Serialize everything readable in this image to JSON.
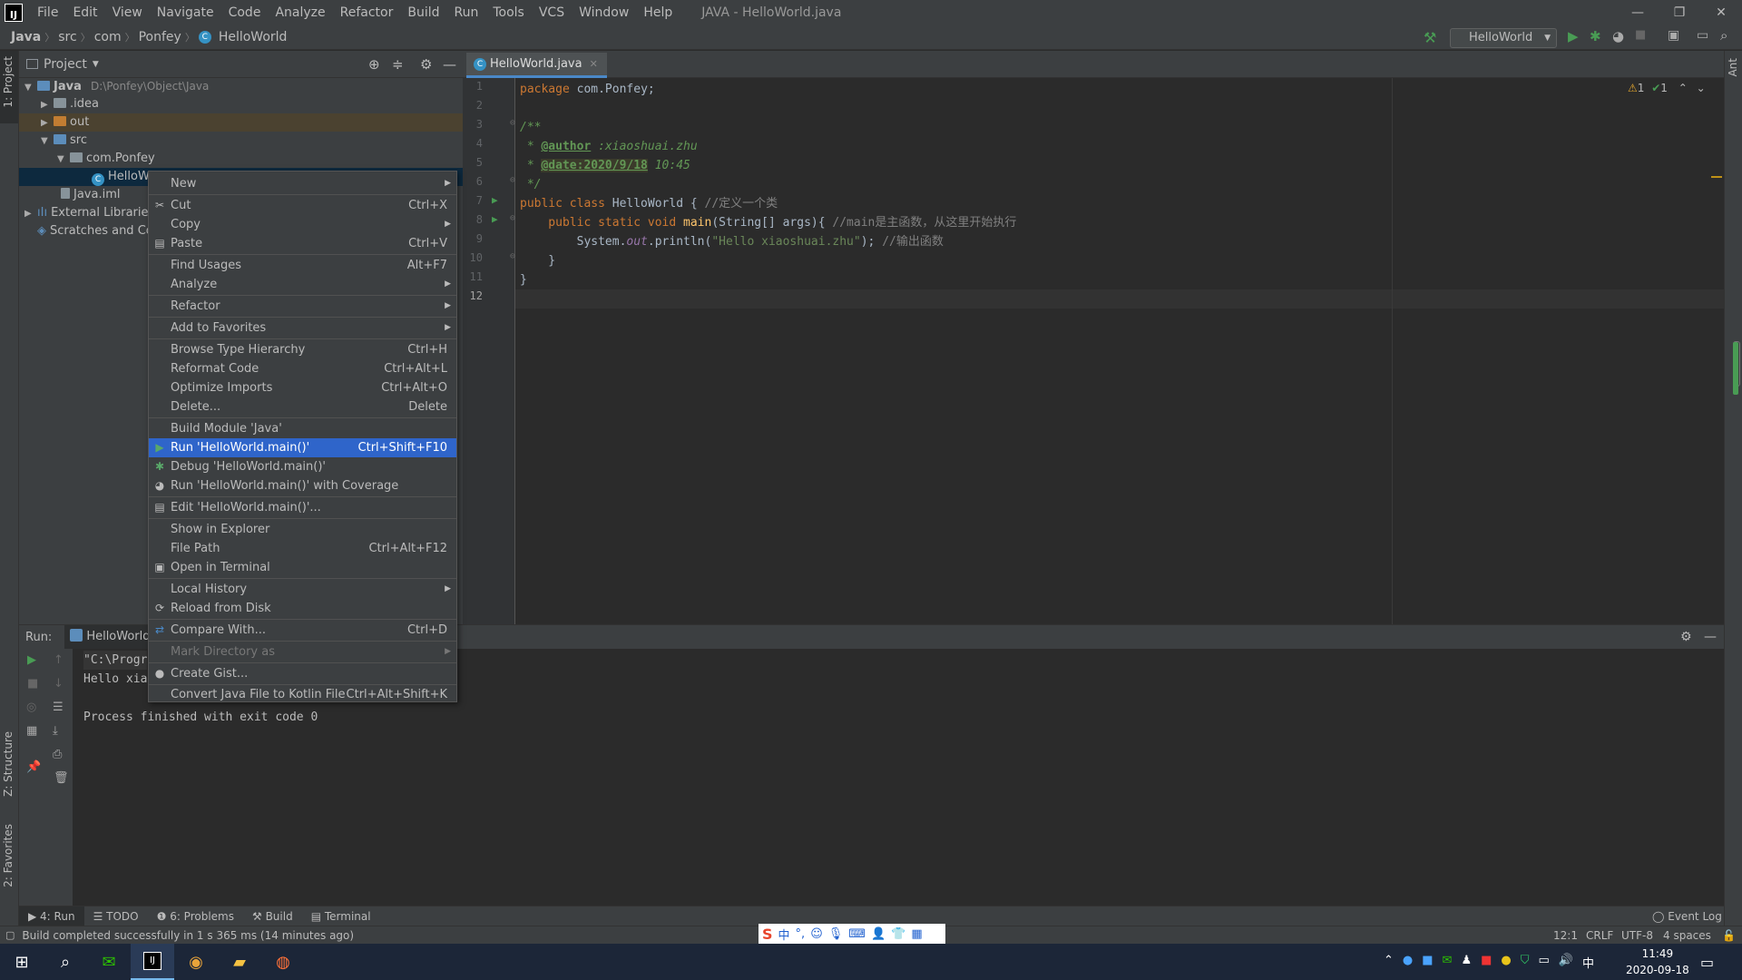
{
  "menubar": {
    "items": [
      "File",
      "Edit",
      "View",
      "Navigate",
      "Code",
      "Analyze",
      "Refactor",
      "Build",
      "Run",
      "Tools",
      "VCS",
      "Window",
      "Help"
    ],
    "window_title": "JAVA - HelloWorld.java",
    "min": "—",
    "restore": "❐",
    "close": "✕"
  },
  "navbar": {
    "crumbs": [
      "Java",
      "src",
      "com",
      "Ponfey",
      "HelloWorld"
    ],
    "run_config": "HelloWorld"
  },
  "left_strip": {
    "project": "1: Project",
    "structure": "Z: Structure",
    "favorites": "2: Favorites"
  },
  "right_strip": {
    "ant": "Ant"
  },
  "project": {
    "title": "Project",
    "tree": [
      {
        "label": "Java",
        "extra": "D:\\Ponfey\\Object\\Java"
      },
      {
        "label": ".idea"
      },
      {
        "label": "out"
      },
      {
        "label": "src"
      },
      {
        "label": "com.Ponfey"
      },
      {
        "label": "HelloWo"
      },
      {
        "label": "Java.iml"
      },
      {
        "label": "External Libraries"
      },
      {
        "label": "Scratches and Co"
      }
    ]
  },
  "editor": {
    "tab": "HelloWorld.java",
    "inspection": {
      "warnings": "1",
      "ok": "1"
    },
    "line_numbers": [
      "1",
      "2",
      "3",
      "4",
      "5",
      "6",
      "7",
      "8",
      "9",
      "10",
      "11",
      "12"
    ],
    "code": {
      "l1_kw": "package",
      "l1_rest": " com.Ponfey;",
      "l3": "/**",
      "l4_pre": " * ",
      "l4_tag": "@author",
      "l4_rest": " :xiaoshuai.zhu",
      "l5_pre": " * ",
      "l5_tag": "@date:2020/9/18",
      "l5_rest": " 10:45",
      "l6": " */",
      "l7_kw": "public class",
      "l7_rest": " HelloWorld { ",
      "l7_cm": "//定义一个类",
      "l8_kw": "    public static void",
      "l8_fn": " main",
      "l8_rest": "(String[] args){ ",
      "l8_cm": "//main是主函数，从这里开始执行",
      "l9_pre": "        System.",
      "l9_it": "out",
      "l9_mid": ".println(",
      "l9_str": "\"Hello xiaoshuai.zhu\"",
      "l9_end": "); ",
      "l9_cm": "//输出函数",
      "l10": "    }",
      "l11": "}"
    }
  },
  "run": {
    "label": "Run:",
    "tab": "HelloWorld",
    "output": [
      "\"C:\\Progr",
      "Hello xia",
      "",
      "Process finished with exit code 0"
    ]
  },
  "context_menu": {
    "items": [
      {
        "label": "New",
        "shortcut": "",
        "submenu": true
      },
      {
        "label": "Cut",
        "shortcut": "Ctrl+X",
        "icon": "✂"
      },
      {
        "label": "Copy",
        "shortcut": "",
        "submenu": true
      },
      {
        "label": "Paste",
        "shortcut": "Ctrl+V",
        "icon": "📋"
      },
      {
        "label": "Find Usages",
        "shortcut": "Alt+F7"
      },
      {
        "label": "Analyze",
        "shortcut": "",
        "submenu": true
      },
      {
        "label": "Refactor",
        "shortcut": "",
        "submenu": true
      },
      {
        "label": "Add to Favorites",
        "shortcut": "",
        "submenu": true
      },
      {
        "label": "Browse Type Hierarchy",
        "shortcut": "Ctrl+H"
      },
      {
        "label": "Reformat Code",
        "shortcut": "Ctrl+Alt+L"
      },
      {
        "label": "Optimize Imports",
        "shortcut": "Ctrl+Alt+O"
      },
      {
        "label": "Delete...",
        "shortcut": "Delete"
      },
      {
        "label": "Build Module 'Java'",
        "shortcut": ""
      },
      {
        "label": "Run 'HelloWorld.main()'",
        "shortcut": "Ctrl+Shift+F10"
      },
      {
        "label": "Debug 'HelloWorld.main()'",
        "shortcut": ""
      },
      {
        "label": "Run 'HelloWorld.main()' with Coverage",
        "shortcut": ""
      },
      {
        "label": "Edit 'HelloWorld.main()'...",
        "shortcut": ""
      },
      {
        "label": "Show in Explorer",
        "shortcut": ""
      },
      {
        "label": "File Path",
        "shortcut": "Ctrl+Alt+F12"
      },
      {
        "label": "Open in Terminal",
        "shortcut": ""
      },
      {
        "label": "Local History",
        "shortcut": "",
        "submenu": true
      },
      {
        "label": "Reload from Disk",
        "shortcut": ""
      },
      {
        "label": "Compare With...",
        "shortcut": "Ctrl+D"
      },
      {
        "label": "Mark Directory as",
        "shortcut": "",
        "submenu": true
      },
      {
        "label": "Create Gist...",
        "shortcut": ""
      },
      {
        "label": "Convert Java File to Kotlin File",
        "shortcut": "Ctrl+Alt+Shift+K"
      }
    ]
  },
  "bottom_tabs": [
    "4: Run",
    "TODO",
    "6: Problems",
    "Build",
    "Terminal"
  ],
  "event_log": "Event Log",
  "status": {
    "message": "Build completed successfully in 1 s 365 ms (14 minutes ago)",
    "position": "12:1",
    "line_sep": "CRLF",
    "encoding": "UTF-8",
    "indent": "4 spaces"
  },
  "ime": {
    "brand": "S",
    "lang": "中"
  },
  "taskbar": {
    "time": "11:49",
    "date": "2020-09-18",
    "input": "中"
  },
  "colors": {
    "accent": "#2f65ca",
    "run_green": "#499c54",
    "tab_underline": "#4a88c7"
  }
}
